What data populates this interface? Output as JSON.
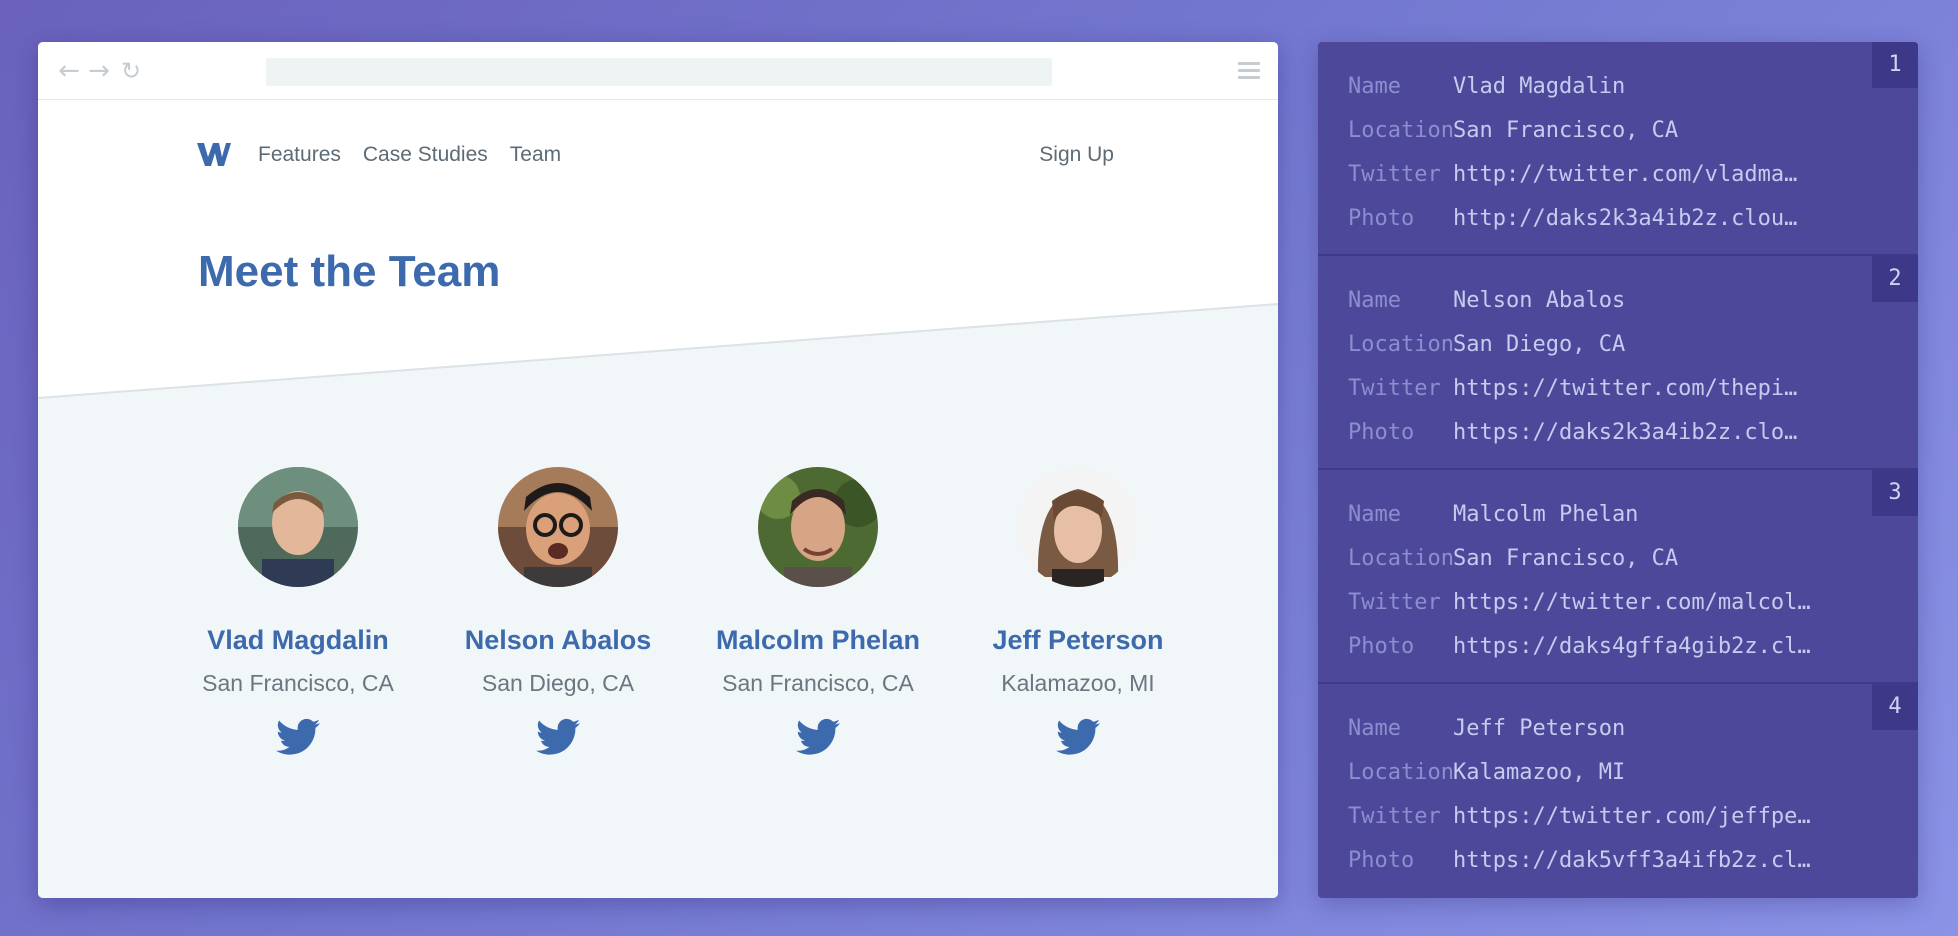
{
  "browser": {
    "nav_back_icon": "arrow-left-icon",
    "nav_forward_icon": "arrow-right-icon",
    "reload_icon": "reload-icon",
    "menu_icon": "hamburger-menu-icon"
  },
  "site": {
    "nav": [
      "Features",
      "Case Studies",
      "Team"
    ],
    "signup": "Sign Up",
    "title": "Meet the Team",
    "brand_color": "#3d6aad"
  },
  "team": [
    {
      "name": "Vlad Magdalin",
      "location": "San Francisco, CA"
    },
    {
      "name": "Nelson Abalos",
      "location": "San Diego, CA"
    },
    {
      "name": "Malcolm Phelan",
      "location": "San Francisco, CA"
    },
    {
      "name": "Jeff Peterson",
      "location": "Kalamazoo, MI"
    }
  ],
  "records": [
    {
      "num": "1",
      "fields": [
        {
          "key": "Name",
          "value": "Vlad Magdalin"
        },
        {
          "key": "Location",
          "value": "San Francisco, CA"
        },
        {
          "key": "Twitter",
          "value": "http://twitter.com/vladma…"
        },
        {
          "key": "Photo",
          "value": "http://daks2k3a4ib2z.clou…"
        }
      ]
    },
    {
      "num": "2",
      "fields": [
        {
          "key": "Name",
          "value": "Nelson Abalos"
        },
        {
          "key": "Location",
          "value": "San Diego, CA"
        },
        {
          "key": "Twitter",
          "value": "https://twitter.com/thepi…"
        },
        {
          "key": "Photo",
          "value": "https://daks2k3a4ib2z.clo…"
        }
      ]
    },
    {
      "num": "3",
      "fields": [
        {
          "key": "Name",
          "value": "Malcolm Phelan"
        },
        {
          "key": "Location",
          "value": "San Francisco, CA"
        },
        {
          "key": "Twitter",
          "value": "https://twitter.com/malcol…"
        },
        {
          "key": "Photo",
          "value": "https://daks4gffa4gib2z.cl…"
        }
      ]
    },
    {
      "num": "4",
      "fields": [
        {
          "key": "Name",
          "value": "Jeff Peterson"
        },
        {
          "key": "Location",
          "value": "Kalamazoo, MI"
        },
        {
          "key": "Twitter",
          "value": "https://twitter.com/jeffpe…"
        },
        {
          "key": "Photo",
          "value": "https://dak5vff3a4ifb2z.cl…"
        }
      ]
    }
  ]
}
